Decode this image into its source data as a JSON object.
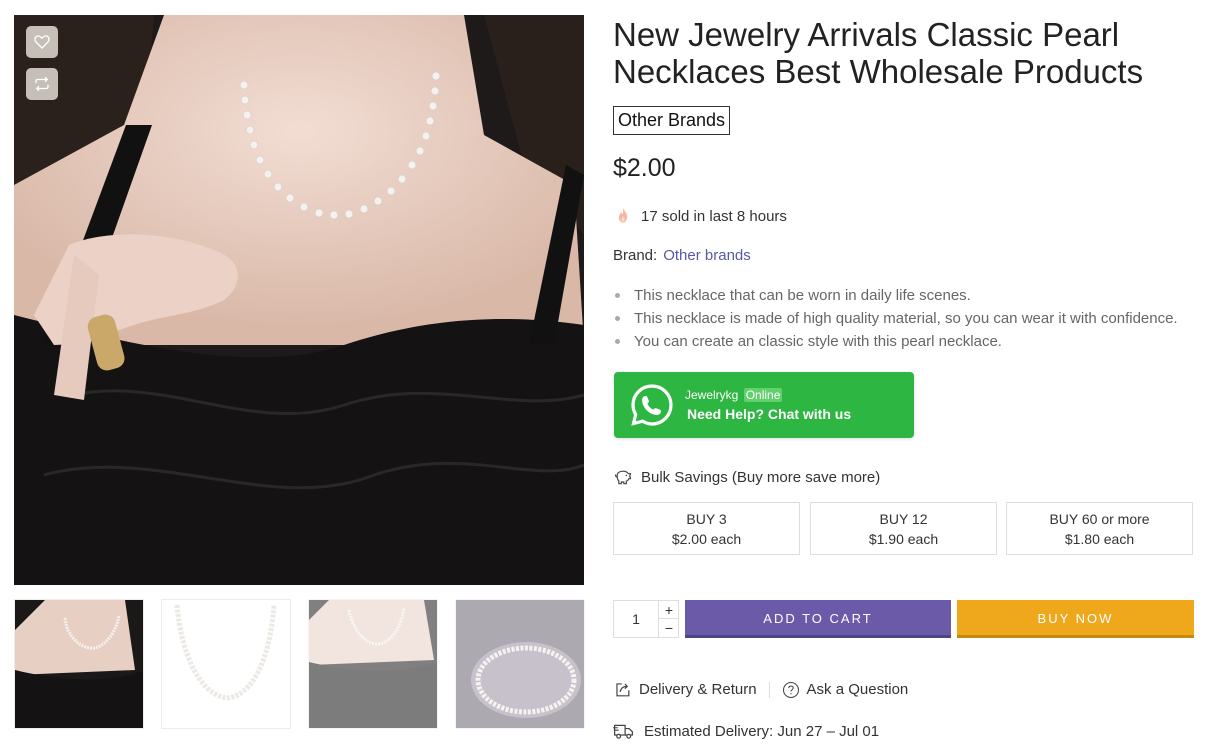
{
  "product": {
    "title": "New Jewelry Arrivals Classic Pearl Necklaces Best Wholesale Products",
    "brand_badge": "Other Brands",
    "price": "$2.00",
    "sold_text": "17 sold in last 8 hours",
    "brand_label": "Brand:",
    "brand_link": "Other brands",
    "features": [
      "This necklace that can be worn in daily life scenes.",
      "This necklace is made of high quality material, so you can wear it with confidence.",
      "You can create an classic style with this pearl necklace."
    ]
  },
  "whatsapp": {
    "name": "Jewelrykg",
    "status": "Online",
    "text": "Need Help? Chat with us",
    "color": "#2db642"
  },
  "bulk": {
    "title": "Bulk Savings (Buy more save more)",
    "tiers": [
      {
        "label": "BUY 3",
        "price": "$2.00 each"
      },
      {
        "label": "BUY 12",
        "price": "$1.90 each"
      },
      {
        "label": "BUY 60 or more",
        "price": "$1.80 each"
      }
    ]
  },
  "purchase": {
    "quantity": "1",
    "plus": "+",
    "minus": "−",
    "add_to_cart": "ADD TO CART",
    "buy_now": "BUY NOW",
    "cart_color": "#6a5aa8",
    "buy_color": "#efa71b"
  },
  "links": {
    "delivery_return": "Delivery & Return",
    "ask_question": "Ask a Question"
  },
  "delivery": {
    "text": "Estimated Delivery: Jun 27 – Jul 01"
  },
  "icons": {
    "wishlist": "heart-icon",
    "compare": "compare-arrows-icon",
    "sold": "flame-icon",
    "bulk": "piggy-bank-icon",
    "whatsapp": "whatsapp-icon",
    "delivery_return": "share-box-icon",
    "ask": "question-circle-icon",
    "delivery": "truck-icon"
  }
}
